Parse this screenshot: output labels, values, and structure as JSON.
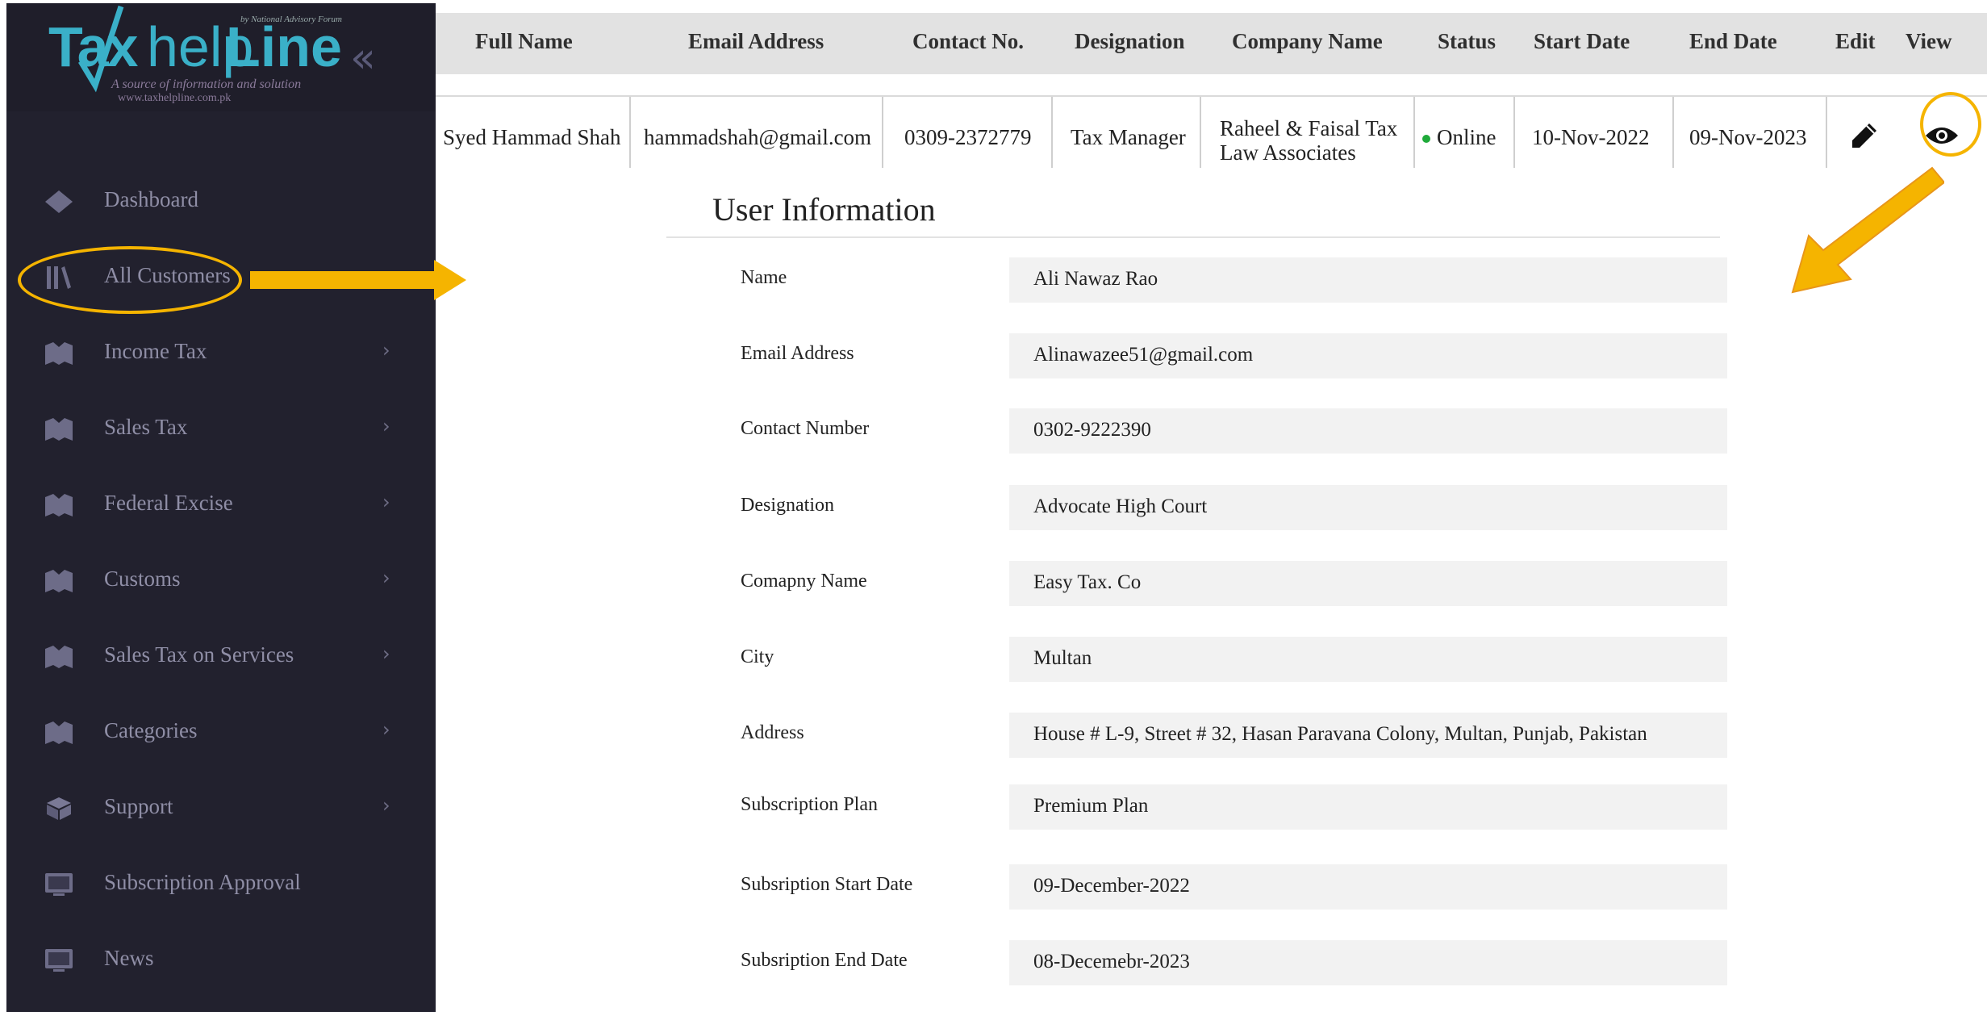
{
  "brand": {
    "top_note": "by National Advisory Forum",
    "logo_tax": "Tax",
    "logo_help": "help",
    "logo_line": "Line",
    "tagline": "A source of information and solution",
    "url": "www.taxhelpline.com.pk",
    "collapse_icon": "«"
  },
  "sidebar": {
    "items": [
      {
        "label": "Dashboard",
        "icon": "diamond-icon",
        "chevron": ""
      },
      {
        "label": "All Customers",
        "icon": "books-icon",
        "chevron": ""
      },
      {
        "label": "Income Tax",
        "icon": "map-icon",
        "chevron": "›"
      },
      {
        "label": "Sales Tax",
        "icon": "map-icon",
        "chevron": "›"
      },
      {
        "label": "Federal Excise",
        "icon": "map-icon",
        "chevron": "›"
      },
      {
        "label": "Customs",
        "icon": "map-icon",
        "chevron": "›"
      },
      {
        "label": "Sales Tax on Services",
        "icon": "map-icon",
        "chevron": "›"
      },
      {
        "label": "Categories",
        "icon": "map-icon",
        "chevron": "›"
      },
      {
        "label": "Support",
        "icon": "cube-icon",
        "chevron": "›"
      },
      {
        "label": "Subscription Approval",
        "icon": "monitor-icon",
        "chevron": ""
      },
      {
        "label": "News",
        "icon": "monitor-icon",
        "chevron": ""
      }
    ]
  },
  "table": {
    "headers": [
      "Full Name",
      "Email Address",
      "Contact No.",
      "Designation",
      "Company Name",
      "Status",
      "Start Date",
      "End Date",
      "Edit",
      "View"
    ],
    "row": {
      "full_name": "Syed Hammad Shah",
      "email": "hammadshah@gmail.com",
      "contact": "0309-2372779",
      "designation": "Tax Manager",
      "company_line1": "Raheel & Faisal Tax",
      "company_line2": "Law Associates",
      "status": "Online",
      "start_date": "10-Nov-2022",
      "end_date": "09-Nov-2023"
    }
  },
  "user_info": {
    "title": "User Information",
    "fields": [
      {
        "label": "Name",
        "value": "Ali Nawaz Rao"
      },
      {
        "label": "Email Address",
        "value": "Alinawazee51@gmail.com"
      },
      {
        "label": "Contact Number",
        "value": "0302-9222390"
      },
      {
        "label": "Designation",
        "value": "Advocate High Court"
      },
      {
        "label": "Comapny Name",
        "value": "Easy Tax. Co"
      },
      {
        "label": "City",
        "value": "Multan"
      },
      {
        "label": "Address",
        "value": "House # L-9, Street # 32, Hasan Paravana Colony, Multan, Punjab, Pakistan"
      },
      {
        "label": "Subscription Plan",
        "value": "Premium Plan"
      },
      {
        "label": "Subsription Start Date",
        "value": "09-December-2022"
      },
      {
        "label": "Subsription End Date",
        "value": "08-Decemebr-2023"
      }
    ]
  },
  "colors": {
    "sidebar_bg": "#22212e",
    "accent_annotation": "#f5b400",
    "status_online": "#1faa3a",
    "logo": "#3ab0c8"
  }
}
